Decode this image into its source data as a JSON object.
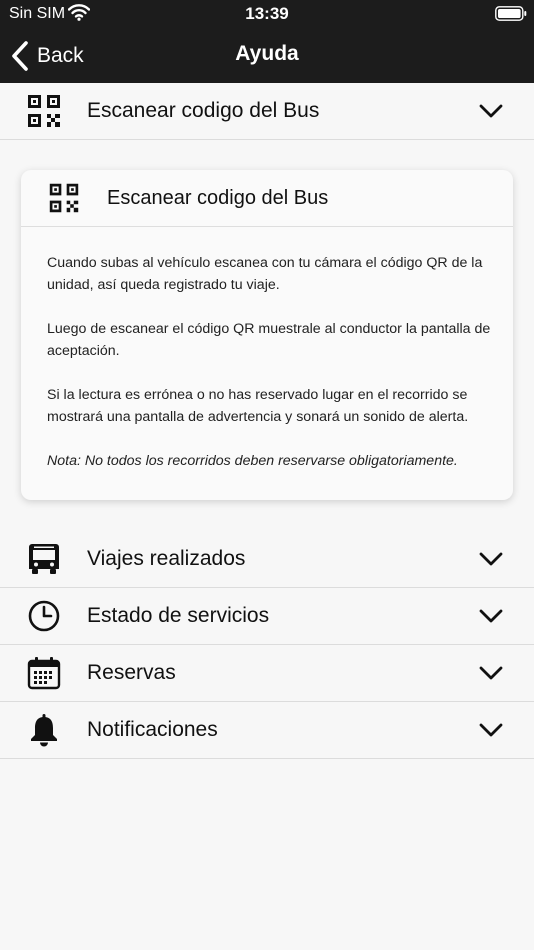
{
  "status_bar": {
    "carrier": "Sin SIM",
    "time": "13:39"
  },
  "nav": {
    "back_label": "Back",
    "title": "Ayuda"
  },
  "sections": [
    {
      "id": "scan",
      "icon": "qr-code-icon",
      "label": "Escanear codigo del Bus",
      "expanded": true
    },
    {
      "id": "trips",
      "icon": "bus-icon",
      "label": "Viajes realizados",
      "expanded": false
    },
    {
      "id": "status",
      "icon": "clock-icon",
      "label": "Estado de servicios",
      "expanded": false
    },
    {
      "id": "bookings",
      "icon": "calendar-icon",
      "label": "Reservas",
      "expanded": false
    },
    {
      "id": "notifications",
      "icon": "bell-icon",
      "label": "Notificaciones",
      "expanded": false
    }
  ],
  "detail_card": {
    "icon": "qr-code-icon",
    "title": "Escanear codigo del Bus",
    "paragraphs": [
      "Cuando subas al vehículo escanea con tu cámara el código QR de la unidad, así queda registrado tu viaje.",
      "Luego de escanear el código QR muestrale al conductor la pantalla de aceptación.",
      "Si la lectura es errónea o no has reservado lugar en el recorrido se mostrará una pantalla de advertencia y sonará un sonido de alerta."
    ],
    "note": "Nota: No todos los recorridos deben reservarse obligatoriamente."
  },
  "colors": {
    "header_bg": "#1c1c1c",
    "page_bg": "#f7f7f7",
    "card_bg": "#fafafa",
    "divider": "#dcdcdc"
  }
}
